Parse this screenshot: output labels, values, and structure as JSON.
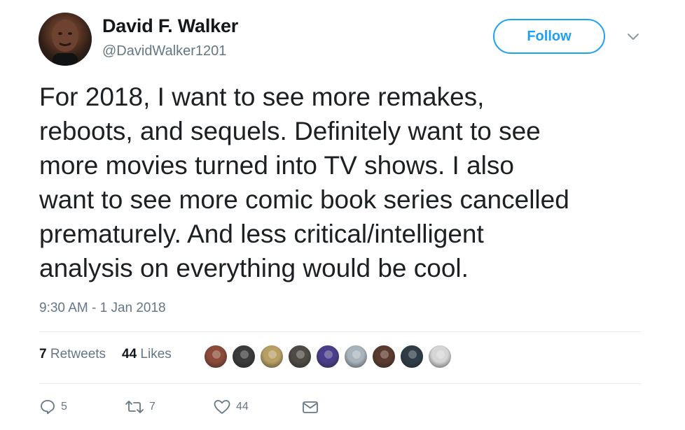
{
  "author": {
    "name": "David F. Walker",
    "handle": "@DavidWalker1201"
  },
  "follow_label": "Follow",
  "tweet_text": "For 2018, I want to see more remakes,\nreboots, and sequels. Definitely want to see\nmore movies turned into TV shows. I also\nwant to see more comic book series cancelled\nprematurely. And less critical/intelligent\nanalysis on everything would be cool.",
  "timestamp": "9:30 AM - 1 Jan 2018",
  "stats": {
    "retweets_count": "7",
    "retweets_label": "Retweets",
    "likes_count": "44",
    "likes_label": "Likes"
  },
  "likers": [
    {
      "icon": "liker-avatar-1",
      "color": "#8b4a3a"
    },
    {
      "icon": "liker-avatar-2",
      "color": "#3a3a3a"
    },
    {
      "icon": "liker-avatar-3",
      "color": "#b8a064"
    },
    {
      "icon": "liker-avatar-4",
      "color": "#4e4a44"
    },
    {
      "icon": "liker-avatar-5",
      "color": "#4a3d8a"
    },
    {
      "icon": "liker-avatar-6",
      "color": "#a9b3bc"
    },
    {
      "icon": "liker-avatar-7",
      "color": "#5a3a2e"
    },
    {
      "icon": "liker-avatar-8",
      "color": "#2f3c46"
    },
    {
      "icon": "liker-avatar-9",
      "color": "#d6d6d6"
    }
  ],
  "actions": {
    "reply_count": "5",
    "retweet_count": "7",
    "like_count": "44"
  },
  "colors": {
    "accent": "#1da1f2",
    "muted": "#657786",
    "text": "#1c2022"
  }
}
